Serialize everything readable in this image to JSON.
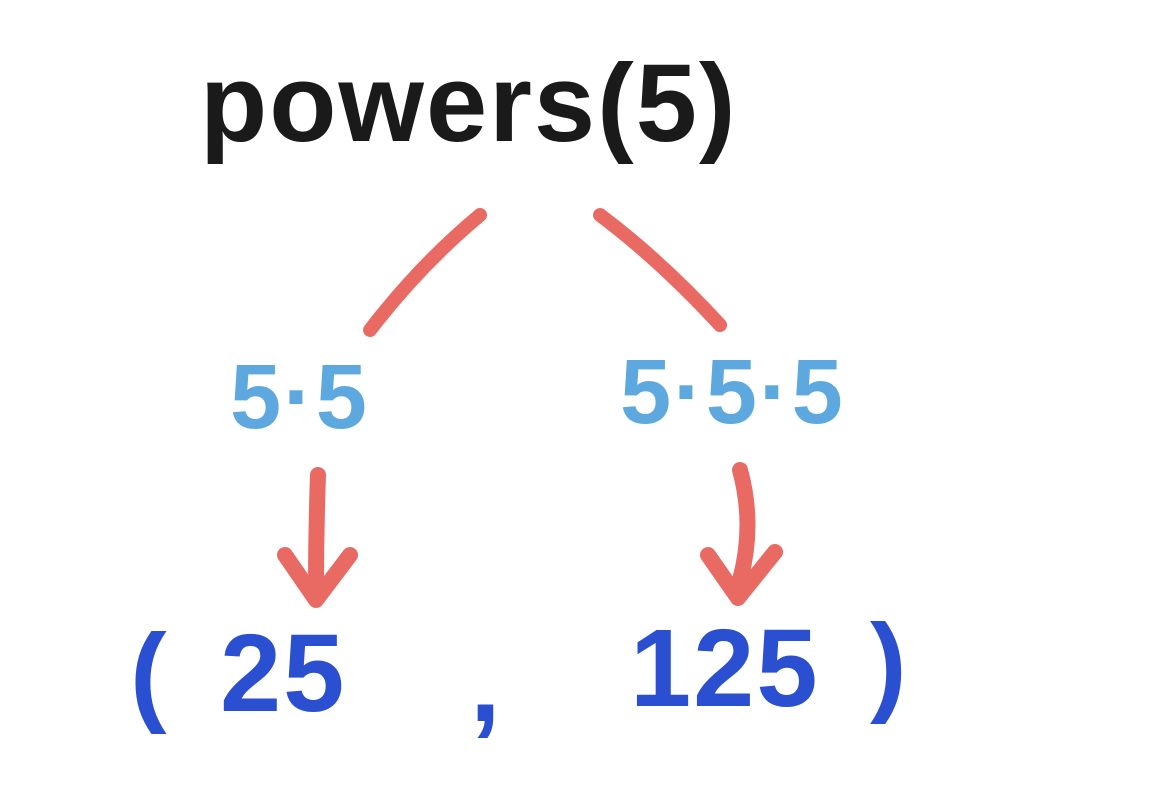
{
  "title": "powers(5)",
  "left": {
    "expression": "5·5",
    "value": "25"
  },
  "right": {
    "expression": "5·5·5",
    "value": "125"
  },
  "result_prefix": "(",
  "result_sep": ",",
  "result_suffix": ")",
  "colors": {
    "title": "#1a1a1a",
    "expr": "#5ea8e0",
    "result": "#2a4fd0",
    "arrow": "#e96a62"
  }
}
